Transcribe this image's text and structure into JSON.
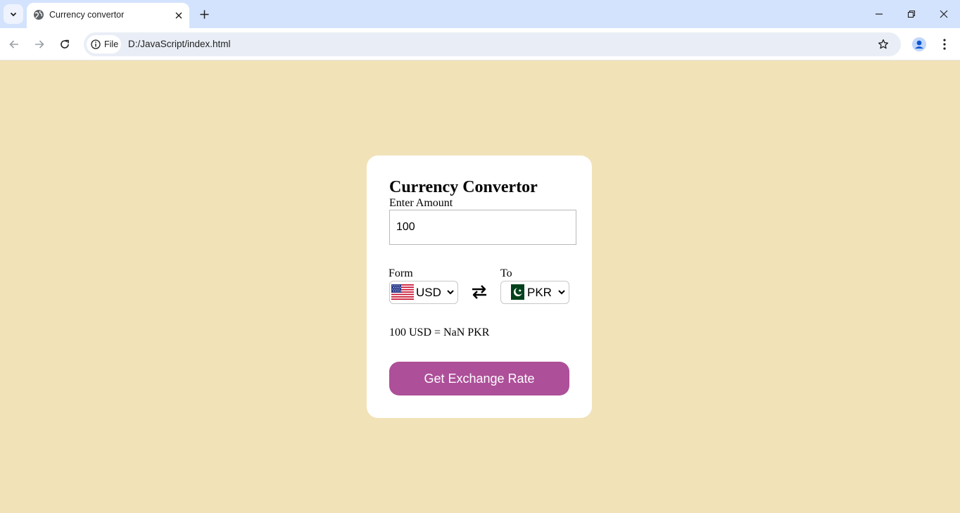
{
  "browser": {
    "tab_title": "Currency convertor",
    "omnibox_chip": "File",
    "url": "D:/JavaScript/index.html"
  },
  "page": {
    "background": "#f2e2b8",
    "title": "Currency Convertor",
    "amount_label": "Enter Amount",
    "amount_value": "100",
    "from_label": "Form",
    "to_label": "To",
    "from_currency": "USD",
    "to_currency": "PKR",
    "result": "100 USD = NaN PKR",
    "button_label": "Get Exchange Rate",
    "button_color": "#ad4f99"
  }
}
